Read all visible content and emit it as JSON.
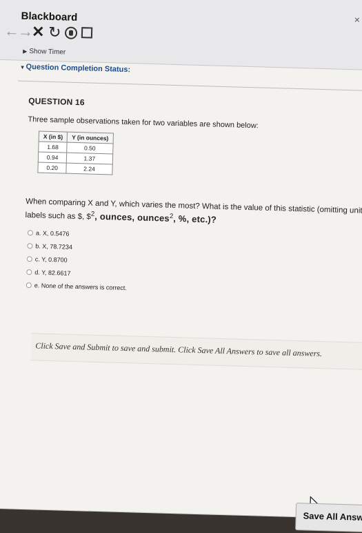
{
  "browser": {
    "tab_title": "Blackboard",
    "close_glyph": "×",
    "show_timer": "Show Timer"
  },
  "status": {
    "label": "Question Completion Status:"
  },
  "question": {
    "title": "QUESTION 16",
    "intro": "Three sample observations taken for two variables are shown below:",
    "table": {
      "headers": [
        "X (in $)",
        "Y (in ounces)"
      ],
      "rows": [
        [
          "1.68",
          "0.50"
        ],
        [
          "0.94",
          "1.37"
        ],
        [
          "0.20",
          "2.24"
        ]
      ]
    },
    "stem_part1": "When comparing X and Y, which varies the most? What is the value of this statistic (omitting unit labels such as $, $",
    "stem_part2": "2",
    "stem_part3": ", ounces, ounces",
    "stem_part4": "2",
    "stem_part5": ", %, etc.)?",
    "options": [
      {
        "label": "a. X, 0.5476"
      },
      {
        "label": "b. X, 78.7234"
      },
      {
        "label": "c. Y, 0.8700"
      },
      {
        "label": "d. Y, 82.6617"
      },
      {
        "label": "e. None of the answers is correct."
      }
    ]
  },
  "footer": {
    "save_instructions": "Click Save and Submit to save and submit. Click Save All Answers to save all answers.",
    "save_all_label": "Save All Answers"
  }
}
